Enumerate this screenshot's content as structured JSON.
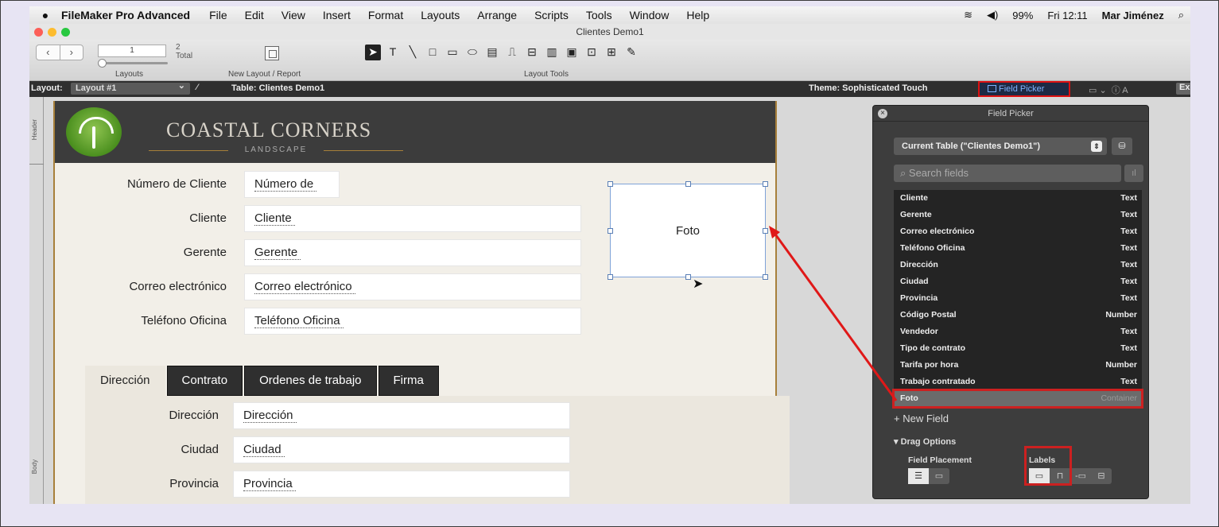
{
  "menubar": {
    "app": "FileMaker Pro Advanced",
    "items": [
      "File",
      "Edit",
      "View",
      "Insert",
      "Format",
      "Layouts",
      "Arrange",
      "Scripts",
      "Tools",
      "Window",
      "Help"
    ],
    "battery": "99%",
    "clock": "Fri 12:11",
    "user": "Mar Jiménez"
  },
  "window": {
    "title": "Clientes Demo1"
  },
  "toolbar": {
    "record": "1",
    "total_count": "2",
    "total_label": "Total",
    "layouts_label": "Layouts",
    "new_layout_label": "New Layout / Report",
    "layout_tools_label": "Layout Tools"
  },
  "layoutbar": {
    "layout_label": "Layout:",
    "layout_name": "Layout #1",
    "table": "Table: Clientes Demo1",
    "theme": "Theme: Sophisticated Touch",
    "field_picker_btn": "Field Picker",
    "exit": "Exi"
  },
  "ruler": {
    "header": "Header",
    "body": "Body"
  },
  "layout": {
    "brand": "COASTAL CORNERS",
    "brand_sub": "LANDSCAPE",
    "fields": [
      {
        "label": "Número de Cliente",
        "value": "Número de"
      },
      {
        "label": "Cliente",
        "value": "Cliente"
      },
      {
        "label": "Gerente",
        "value": "Gerente"
      },
      {
        "label": "Correo electrónico",
        "value": "Correo electrónico"
      },
      {
        "label": "Teléfono Oficina",
        "value": "Teléfono Oficina"
      }
    ],
    "foto": "Foto",
    "tabs": [
      "Dirección",
      "Contrato",
      "Ordenes de trabajo",
      "Firma"
    ],
    "tab_fields": [
      {
        "label": "Dirección",
        "value": "Dirección"
      },
      {
        "label": "Ciudad",
        "value": "Ciudad"
      },
      {
        "label": "Provincia",
        "value": "Provincia"
      }
    ]
  },
  "picker": {
    "title": "Field Picker",
    "table_select": "Current Table (\"Clientes Demo1\")",
    "search_placeholder": "Search fields",
    "fields": [
      {
        "name": "Cliente",
        "type": "Text"
      },
      {
        "name": "Gerente",
        "type": "Text"
      },
      {
        "name": "Correo electrónico",
        "type": "Text"
      },
      {
        "name": "Teléfono Oficina",
        "type": "Text"
      },
      {
        "name": "Dirección",
        "type": "Text"
      },
      {
        "name": "Ciudad",
        "type": "Text"
      },
      {
        "name": "Provincia",
        "type": "Text"
      },
      {
        "name": "Código Postal",
        "type": "Number"
      },
      {
        "name": "Vendedor",
        "type": "Text"
      },
      {
        "name": "Tipo de contrato",
        "type": "Text"
      },
      {
        "name": "Tarifa por hora",
        "type": "Number"
      },
      {
        "name": "Trabajo contratado",
        "type": "Text"
      },
      {
        "name": "Foto",
        "type": "Container"
      }
    ],
    "new_field": "+ New Field",
    "drag_options": "Drag Options",
    "field_placement": "Field Placement",
    "labels": "Labels"
  },
  "colors": {
    "highlight": "#cc2020",
    "accent_border": "#a77f3a",
    "picker_bg": "#3d3d3d"
  }
}
